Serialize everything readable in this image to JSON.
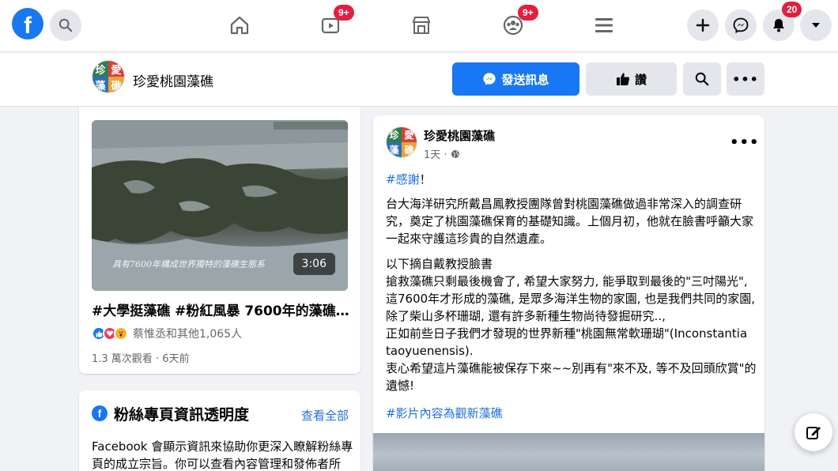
{
  "colors": {
    "brand": "#1877f2",
    "badge": "#e41e3f",
    "link": "#216fdb"
  },
  "topbar": {
    "logo_letter": "f",
    "nav": [
      {
        "name": "home-icon"
      },
      {
        "name": "watch-icon",
        "badge": "9+"
      },
      {
        "name": "marketplace-icon"
      },
      {
        "name": "groups-icon",
        "badge": "9+"
      },
      {
        "name": "menu-icon"
      }
    ],
    "notifications_badge": "20"
  },
  "pagebar": {
    "avatar_chars": [
      "珍",
      "愛",
      "藻",
      "礁"
    ],
    "page_name": "珍愛桃園藻礁",
    "message_button": "發送訊息",
    "like_button": "讚"
  },
  "video_card": {
    "duration": "3:06",
    "subtitle": "具有7600年構成世界獨特的藻礁生態系",
    "title": "#大學挺藻礁 #粉紅風暴 7600年的藻礁提...",
    "reaction_text": "蔡惟丞和其他1,065人",
    "views": "1.3 萬次觀看 · 6天前"
  },
  "transparency_card": {
    "title": "粉絲專頁資訊透明度",
    "see_all": "查看全部",
    "body_line1": "Facebook 會顯示資訊來協助你更深入瞭解粉絲專",
    "body_line2": "頁的成立宗旨。你可以查看內容管理和發佈者所"
  },
  "post": {
    "page_name": "珍愛桃園藻礁",
    "time": "1天 ·",
    "hashtag_thanks": "#感謝",
    "thanks_suffix": "！",
    "para1": [
      "台大海洋研究所戴昌鳳教授團隊曾對桃園藻礁做過非常深入的調查研",
      "究，奠定了桃園藻礁保育的基礎知識。上個月初，他就在臉書呼籲大家",
      "一起來守護這珍貴的自然遺產。"
    ],
    "para2": [
      "以下摘自戴教授臉書",
      "搶救藻礁只剩最後機會了, 希望大家努力, 能爭取到最後的\"三吋陽光\",",
      "這7600年才形成的藻礁, 是眾多海洋生物的家園, 也是我們共同的家園,",
      "除了柴山多杯珊瑚, 還有許多新種生物尚待發掘研究..,",
      "正如前些日子我們才發現的世界新種\"桃園無常軟珊瑚\"(Inconstantia",
      "taoyuenensis).",
      "衷心希望這片藻礁能被保存下來~~別再有\"來不及, 等不及回頭欣賞\"的",
      "遺憾!"
    ],
    "hashtag_footer": "#影片內容為觀新藻礁"
  }
}
